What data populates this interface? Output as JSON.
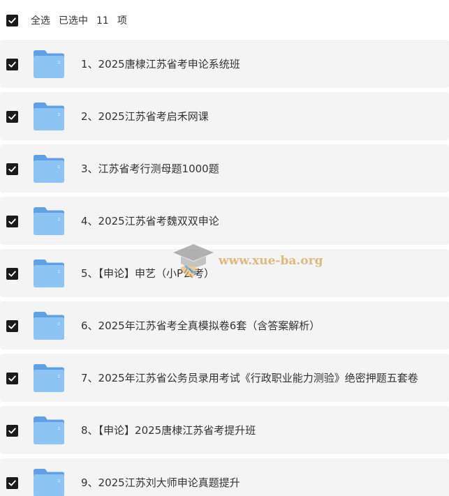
{
  "header": {
    "select_all_label": "全选",
    "selected_prefix": "已选中",
    "selected_count": "11",
    "selected_suffix": "项",
    "checked": true
  },
  "items": [
    {
      "label": "1、2025唐棣江苏省考申论系统班",
      "checked": true,
      "icon": "folder-icon"
    },
    {
      "label": "2、2025江苏省考启禾网课",
      "checked": true,
      "icon": "folder-icon"
    },
    {
      "label": "3、江苏省考行测母题1000题",
      "checked": true,
      "icon": "folder-icon"
    },
    {
      "label": "4、2025江苏省考魏双双申论",
      "checked": true,
      "icon": "folder-icon"
    },
    {
      "label": "5、【申论】申艺（小P公考）",
      "checked": true,
      "icon": "folder-icon"
    },
    {
      "label": "6、2025年江苏省考全真模拟卷6套（含答案解析）",
      "checked": true,
      "icon": "folder-icon"
    },
    {
      "label": "7、2025年江苏省公务员录用考试《行政职业能力测验》绝密押题五套卷",
      "checked": true,
      "icon": "folder-icon"
    },
    {
      "label": "8、【申论】2025唐棣江苏省考提升班",
      "checked": true,
      "icon": "folder-icon"
    },
    {
      "label": "9、2025江苏刘大师申论真题提升",
      "checked": true,
      "icon": "folder-icon"
    }
  ],
  "watermark": {
    "text": "www.xue-ba.org",
    "icon": "graduation-cap-icon"
  },
  "colors": {
    "row_background": "#f4f4f5",
    "checkbox": "#1b1b1b",
    "folder": "#7fb8f0",
    "watermark": "#d9a657"
  }
}
